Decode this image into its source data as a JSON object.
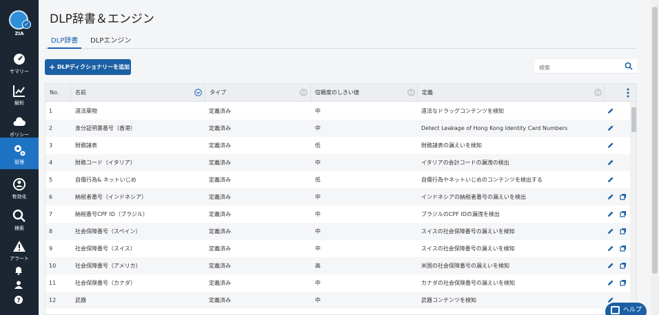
{
  "app": {
    "logo_text": "ZIA"
  },
  "sidebar": {
    "items": [
      {
        "label": "サマリー",
        "icon": "dashboard-icon"
      },
      {
        "label": "解析",
        "icon": "chart-icon"
      },
      {
        "label": "ポリシー",
        "icon": "cloud-icon"
      },
      {
        "label": "管理",
        "icon": "gear-icon",
        "active": true
      },
      {
        "label": "有効化",
        "icon": "activate-icon"
      },
      {
        "label": "検索",
        "icon": "search-icon"
      },
      {
        "label": "アラート",
        "icon": "alert-icon"
      }
    ]
  },
  "page": {
    "title": "DLP辞書＆エンジン"
  },
  "tabs": [
    {
      "label": "DLP辞書"
    },
    {
      "label": "DLPエンジン"
    }
  ],
  "toolbar": {
    "add_label": "DLPディクショナリーを追加",
    "search_placeholder": "検索"
  },
  "table": {
    "columns": [
      {
        "label": "No."
      },
      {
        "label": "名前"
      },
      {
        "label": "タイプ"
      },
      {
        "label": "信頼度のしきい値"
      },
      {
        "label": "定義"
      }
    ],
    "rows": [
      {
        "no": "1",
        "name": "違法薬物",
        "type": "定義済み",
        "threshold": "中",
        "definition": "違法なドラッグコンテンツを検知",
        "copy": false
      },
      {
        "no": "2",
        "name": "身分証明書番号（香港）",
        "type": "定義済み",
        "threshold": "中",
        "definition": "Detect Leakage of Hong Kong Identity Card Numbers",
        "copy": false
      },
      {
        "no": "3",
        "name": "財務諸表",
        "type": "定義済み",
        "threshold": "低",
        "definition": "財務諸表の漏えいを検知",
        "copy": false
      },
      {
        "no": "4",
        "name": "財務コード（イタリア）",
        "type": "定義済み",
        "threshold": "中",
        "definition": "イタリアの会計コードの漏洩の検出",
        "copy": false
      },
      {
        "no": "5",
        "name": "自傷行為& ネットいじめ",
        "type": "定義済み",
        "threshold": "低",
        "definition": "自傷行為やネットいじめのコンテンツを検出する",
        "copy": false
      },
      {
        "no": "6",
        "name": "納税者番号（インドネシア）",
        "type": "定義済み",
        "threshold": "中",
        "definition": "インドネシアの納税者番号の漏えいを検出",
        "copy": true
      },
      {
        "no": "7",
        "name": "納税番号CPF ID（ブラジル）",
        "type": "定義済み",
        "threshold": "中",
        "definition": "ブラジルのCPF IDの漏洩を検出",
        "copy": true
      },
      {
        "no": "8",
        "name": "社会保障番号（スペイン）",
        "type": "定義済み",
        "threshold": "中",
        "definition": "スイスの社会保障番号の漏えいを検知",
        "copy": true
      },
      {
        "no": "9",
        "name": "社会保障番号（スイス）",
        "type": "定義済み",
        "threshold": "中",
        "definition": "スイスの社会保障番号の漏えいを検知",
        "copy": true
      },
      {
        "no": "10",
        "name": "社会保障番号（アメリカ）",
        "type": "定義済み",
        "threshold": "高",
        "definition": "米国の社会保障番号の漏えいを検知",
        "copy": true
      },
      {
        "no": "11",
        "name": "社会保険番号（カナダ）",
        "type": "定義済み",
        "threshold": "中",
        "definition": "カナダの社会保険番号の漏えいを検知",
        "copy": true
      },
      {
        "no": "12",
        "name": "武器",
        "type": "定義済み",
        "threshold": "中",
        "definition": "武器コンテンツを検知",
        "copy": false
      }
    ]
  },
  "help": {
    "label": "ヘルプ"
  },
  "colors": {
    "sidebar_bg": "#1b2632",
    "accent": "#1f73c4",
    "button": "#1b5fa4"
  }
}
